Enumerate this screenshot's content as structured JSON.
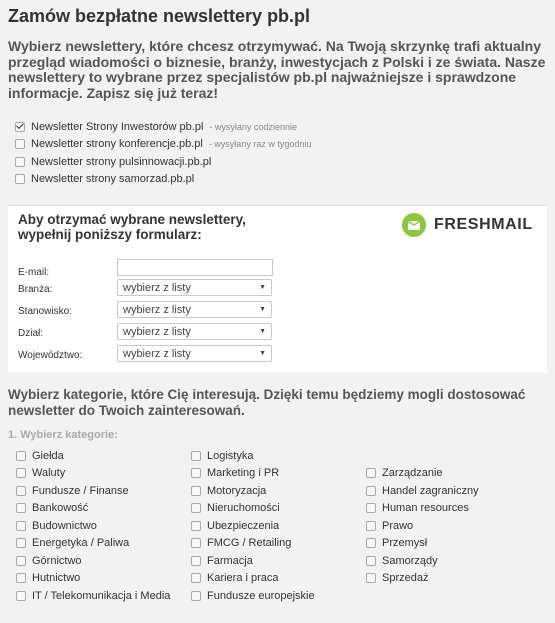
{
  "page": {
    "title": "Zamów bezpłatne newslettery pb.pl",
    "intro": "Wybierz newslettery, które chcesz otrzymywać. Na Twoją skrzynkę trafi aktualny przegląd wiadomości o biznesie, branży, inwestycjach z Polski i ze świata. Nasze newslettery to wybrane przez specjalistów pb.pl najważniejsze i sprawdzone informacje. Zapisz się już teraz!"
  },
  "newsletters": [
    {
      "label": "Newsletter Strony Inwestorów pb.pl",
      "note": "- wysyłany codziennie",
      "checked": true
    },
    {
      "label": "Newsletter strony konferencje.pb.pl",
      "note": "- wysyłany raz w tygodniu",
      "checked": false
    },
    {
      "label": "Newsletter strony pulsinnowacji.pb.pl",
      "note": "",
      "checked": false
    },
    {
      "label": "Newsletter strony samorzad.pb.pl",
      "note": "",
      "checked": false
    }
  ],
  "form": {
    "heading_line1": "Aby otrzymać wybrane newslettery,",
    "heading_line2": "wypełnij poniższy formularz:",
    "logo_text": "FRESHMAIL",
    "logo_icon": "freshmail-logo-icon",
    "brand_color": "#8cc63f",
    "email_label": "E-mail:",
    "email_value": "",
    "fields": [
      {
        "label": "Branża:",
        "value": "wybierz z listy"
      },
      {
        "label": "Stanowisko:",
        "value": "wybierz z listy"
      },
      {
        "label": "Dział:",
        "value": "wybierz z listy"
      },
      {
        "label": "Województwo:",
        "value": "wybierz z listy"
      }
    ]
  },
  "categories": {
    "intro": "Wybierz kategorie, które Cię interesują. Dzięki temu będziemy mogli dostosować newsletter do Twoich zainteresowań.",
    "subheading": "1. Wybierz kategorie:",
    "col1": [
      "Giełda",
      "Waluty",
      "Fundusze / Finanse",
      "Bankowość",
      "Budownictwo",
      "Energetyka / Paliwa",
      "Górnictwo",
      "Hutnictwo",
      "IT / Telekomunikacja i Media"
    ],
    "col2": [
      "Logistyka",
      "Marketing i PR",
      "Motoryzacja",
      "Nieruchomości",
      "Ubezpieczenia",
      "FMCG / Retailing",
      "Farmacja",
      "Kariera i praca",
      "Fundusze europejskie"
    ],
    "col3": [
      "Zarządzanie",
      "Handel zagraniczny",
      "Human resources",
      "Prawo",
      "Przemysł",
      "Samorządy",
      "Sprzedaż"
    ]
  }
}
